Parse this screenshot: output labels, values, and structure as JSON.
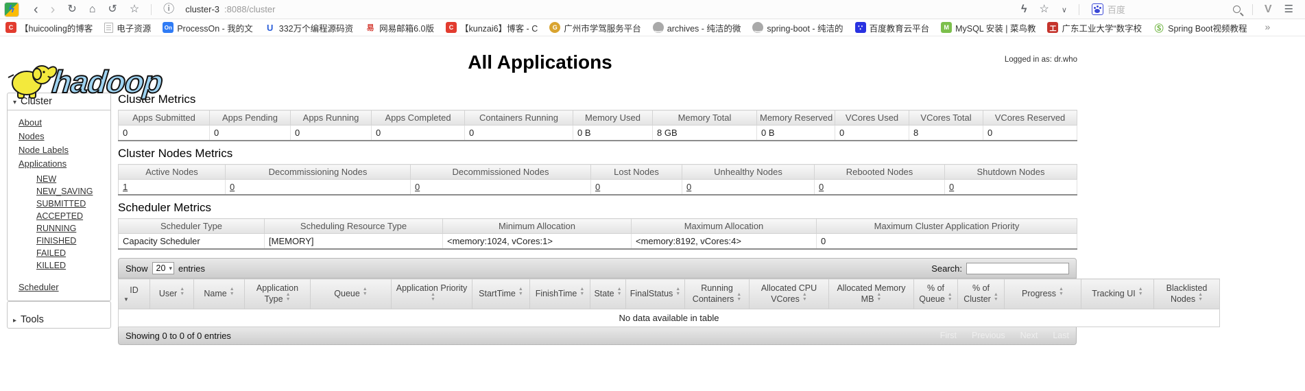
{
  "browser": {
    "url_host": "cluster-3",
    "url_rest": ":8088/cluster",
    "baidu_label": "百度"
  },
  "bookmarks": {
    "items": [
      {
        "glyph": "C",
        "label": "【huicooling的博客"
      },
      {
        "glyph": "",
        "label": "电子资源"
      },
      {
        "glyph": "On",
        "label": "ProcessOn - 我的文"
      },
      {
        "glyph": "U",
        "label": "332万个编程源码资"
      },
      {
        "glyph": "易",
        "label": "网易邮箱6.0版"
      },
      {
        "glyph": "C",
        "label": "【kunzai6】博客 - C"
      },
      {
        "glyph": "G",
        "label": "广州市学驾服务平台"
      },
      {
        "glyph": "‿",
        "label": "archives - 纯洁的微"
      },
      {
        "glyph": "‿",
        "label": "spring-boot - 纯洁的"
      },
      {
        "glyph": "∵",
        "label": "百度教育云平台"
      },
      {
        "glyph": "M",
        "label": "MySQL 安装 | 菜鸟教"
      },
      {
        "glyph": "工",
        "label": "广东工业大学“数字校"
      },
      {
        "glyph": "Ⓢ",
        "label": "Spring Boot视频教程"
      }
    ]
  },
  "page": {
    "logged_in": "Logged in as: dr.who",
    "logo_text": "hadoop",
    "title": "All Applications",
    "sidebar": {
      "cluster_header": "Cluster",
      "links": [
        "About",
        "Nodes",
        "Node Labels",
        "Applications"
      ],
      "states": [
        "NEW",
        "NEW_SAVING",
        "SUBMITTED",
        "ACCEPTED",
        "RUNNING",
        "FINISHED",
        "FAILED",
        "KILLED"
      ],
      "scheduler_link": "Scheduler",
      "tools_header": "Tools"
    },
    "cluster_metrics": {
      "title": "Cluster Metrics",
      "columns": [
        "Apps Submitted",
        "Apps Pending",
        "Apps Running",
        "Apps Completed",
        "Containers Running",
        "Memory Used",
        "Memory Total",
        "Memory Reserved",
        "VCores Used",
        "VCores Total",
        "VCores Reserved"
      ],
      "values": [
        "0",
        "0",
        "0",
        "0",
        "0",
        "0 B",
        "8 GB",
        "0 B",
        "0",
        "8",
        "0"
      ]
    },
    "cluster_nodes_metrics": {
      "title": "Cluster Nodes Metrics",
      "columns": [
        "Active Nodes",
        "Decommissioning Nodes",
        "Decommissioned Nodes",
        "Lost Nodes",
        "Unhealthy Nodes",
        "Rebooted Nodes",
        "Shutdown Nodes"
      ],
      "values": [
        "1",
        "0",
        "0",
        "0",
        "0",
        "0",
        "0"
      ]
    },
    "scheduler_metrics": {
      "title": "Scheduler Metrics",
      "columns": [
        "Scheduler Type",
        "Scheduling Resource Type",
        "Minimum Allocation",
        "Maximum Allocation",
        "Maximum Cluster Application Priority"
      ],
      "values": [
        "Capacity Scheduler",
        "[MEMORY]",
        "<memory:1024, vCores:1>",
        "<memory:8192, vCores:4>",
        "0"
      ]
    },
    "apps_table": {
      "show_label": "Show",
      "page_size": "20",
      "entries_label": "entries",
      "search_label": "Search:",
      "columns": [
        "ID",
        "User",
        "Name",
        "Application Type",
        "Queue",
        "Application Priority",
        "StartTime",
        "FinishTime",
        "State",
        "FinalStatus",
        "Running Containers",
        "Allocated CPU VCores",
        "Allocated Memory MB",
        "% of Queue",
        "% of Cluster",
        "Progress",
        "Tracking UI",
        "Blacklisted Nodes"
      ],
      "empty_text": "No data available in table",
      "info_text": "Showing 0 to 0 of 0 entries",
      "pagination": [
        "First",
        "Previous",
        "Next",
        "Last"
      ]
    }
  }
}
